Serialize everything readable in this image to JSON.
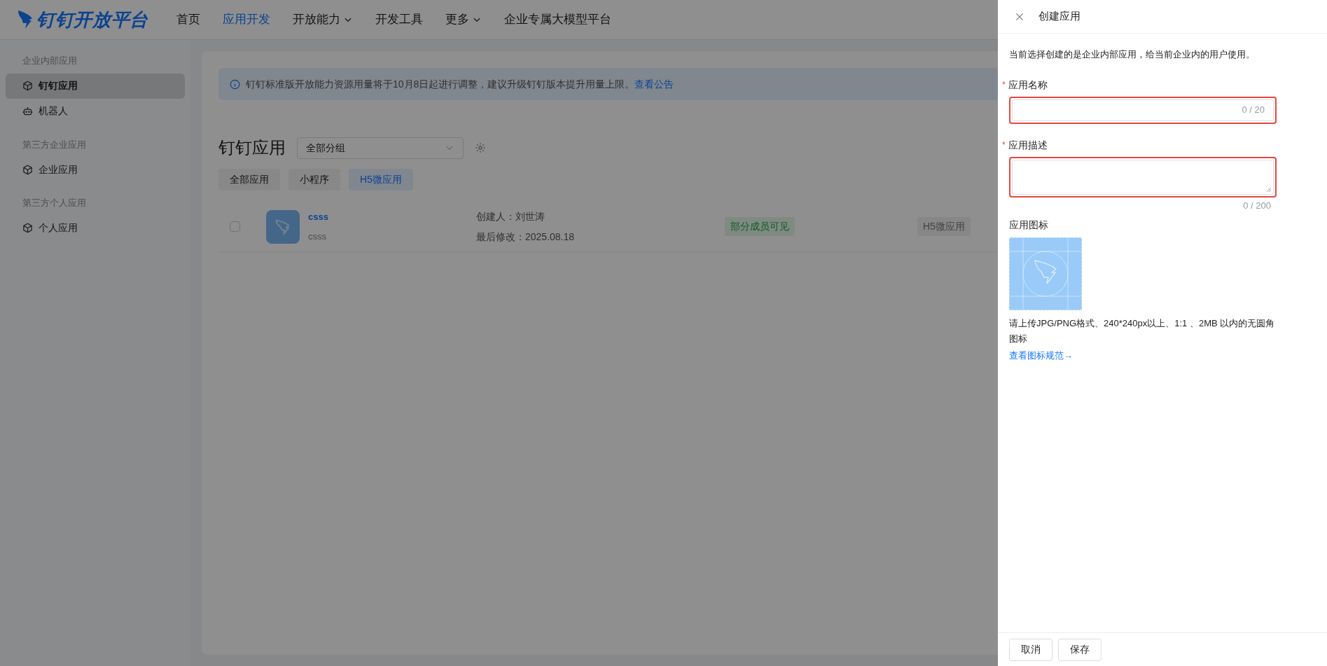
{
  "header": {
    "logo": "钉钉开放平台",
    "nav": [
      {
        "label": "首页",
        "selected": false,
        "dropdown": false
      },
      {
        "label": "应用开发",
        "selected": true,
        "dropdown": false
      },
      {
        "label": "开放能力",
        "selected": false,
        "dropdown": true
      },
      {
        "label": "开发工具",
        "selected": false,
        "dropdown": false
      },
      {
        "label": "更多",
        "selected": false,
        "dropdown": true
      },
      {
        "label": "企业专属大模型平台",
        "selected": false,
        "dropdown": false
      }
    ]
  },
  "sidebar": {
    "groups": [
      {
        "title": "企业内部应用",
        "items": [
          {
            "label": "钉钉应用",
            "kind": "app",
            "selected": true
          },
          {
            "label": "机器人",
            "kind": "bot",
            "selected": false
          }
        ]
      },
      {
        "title": "第三方企业应用",
        "items": [
          {
            "label": "企业应用",
            "kind": "app",
            "selected": false
          }
        ]
      },
      {
        "title": "第三方个人应用",
        "items": [
          {
            "label": "个人应用",
            "kind": "app",
            "selected": false
          }
        ]
      }
    ]
  },
  "notice": {
    "text": "钉钉标准版开放能力资源用量将于10月8日起进行调整，建议升级钉钉版本提升用量上限。",
    "link": "查看公告"
  },
  "content": {
    "title": "钉钉应用",
    "group_select": {
      "value": "全部分组"
    },
    "filters": [
      {
        "label": "全部应用",
        "selected": false
      },
      {
        "label": "小程序",
        "selected": false
      },
      {
        "label": "H5微应用",
        "selected": true
      }
    ],
    "apps": [
      {
        "name": "csss",
        "description": "csss",
        "checked": false,
        "creator": "创建人：刘世涛",
        "modified": "最后修改：2025.08.18",
        "visibility": "部分成员可见",
        "type": "H5微应用"
      }
    ]
  },
  "drawer": {
    "title": "创建应用",
    "intro": "当前选择创建的是企业内部应用，给当前企业内的用户使用。",
    "fields": [
      {
        "kind": "input",
        "label": "应用名称",
        "required_mark": "*",
        "counter": "0 / 20",
        "highlighted": true
      },
      {
        "kind": "textarea",
        "label": "应用描述",
        "required_mark": "*",
        "counter": "0 / 200",
        "highlighted": true
      }
    ],
    "icon_upload": {
      "label": "应用图标",
      "hint": "请上传JPG/PNG格式、240*240px以上、1:1 、2MB 以内的无圆角图标",
      "link": "查看图标规范→"
    },
    "buttons": [
      "取消",
      "保存"
    ]
  }
}
